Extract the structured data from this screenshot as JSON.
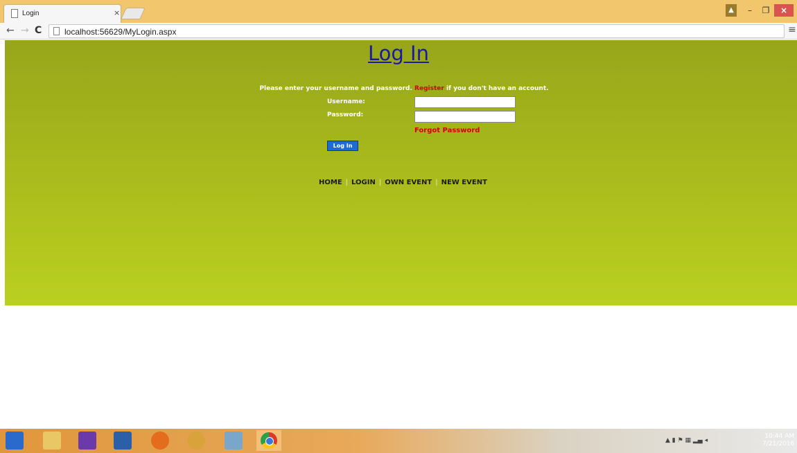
{
  "browser": {
    "tab_title": "Login",
    "tab_close": "×",
    "url": "localhost:56629/MyLogin.aspx"
  },
  "page": {
    "heading": "Log In",
    "intro_pre": "Please enter your username and password.",
    "register_link": "Register",
    "intro_post": "if you don't have an account.",
    "username_label": "Username:",
    "password_label": "Password:",
    "forgot_link": "Forgot Password",
    "login_button": "Log In",
    "nav": [
      "HOME",
      "LOGIN",
      "OWN EVENT",
      "NEW EVENT"
    ],
    "nav_separator": "|"
  },
  "taskbar": {
    "time": "10:44 AM",
    "date": "7/21/2016"
  }
}
